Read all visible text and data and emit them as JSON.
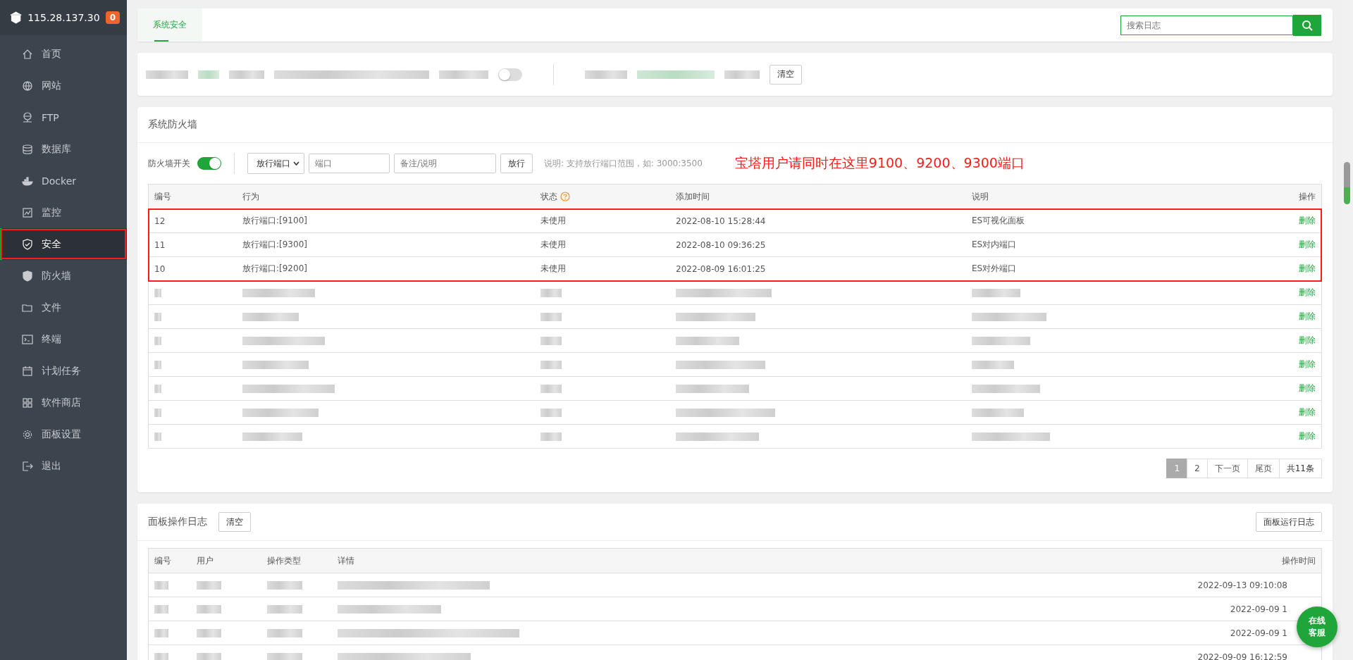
{
  "sidebar": {
    "host": "115.28.137.30",
    "badge": "0",
    "items": [
      {
        "label": "首页",
        "selected": false,
        "highlighted": false
      },
      {
        "label": "网站",
        "selected": false,
        "highlighted": false
      },
      {
        "label": "FTP",
        "selected": false,
        "highlighted": false
      },
      {
        "label": "数据库",
        "selected": false,
        "highlighted": false
      },
      {
        "label": "Docker",
        "selected": false,
        "highlighted": false
      },
      {
        "label": "监控",
        "selected": false,
        "highlighted": false
      },
      {
        "label": "安全",
        "selected": true,
        "highlighted": true
      },
      {
        "label": "防火墙",
        "selected": false,
        "highlighted": false
      },
      {
        "label": "文件",
        "selected": false,
        "highlighted": false
      },
      {
        "label": "终端",
        "selected": false,
        "highlighted": false
      },
      {
        "label": "计划任务",
        "selected": false,
        "highlighted": false
      },
      {
        "label": "软件商店",
        "selected": false,
        "highlighted": false
      },
      {
        "label": "面板设置",
        "selected": false,
        "highlighted": false
      },
      {
        "label": "退出",
        "selected": false,
        "highlighted": false
      }
    ]
  },
  "tabs": [
    {
      "label": "系统安全",
      "selected": true
    }
  ],
  "search": {
    "placeholder": "搜索日志"
  },
  "security_bar": {
    "toggle_on": false,
    "clear_button": "清空"
  },
  "firewall": {
    "title": "系统防火墙",
    "switch_label": "防火墙开关",
    "switch_on": true,
    "select_value": "放行端口",
    "port_placeholder": "端口",
    "note_placeholder": "备注/说明",
    "allow_button": "放行",
    "hint": "说明: 支持放行端口范围，如: 3000:3500",
    "annotation": "宝塔用户请同时在这里9100、9200、9300端口",
    "columns": [
      "编号",
      "行为",
      "状态",
      "添加时间",
      "说明",
      "操作"
    ],
    "rows": [
      {
        "kind": "text",
        "highlighted": true,
        "id": "12",
        "action": "放行端口:[9100]",
        "status": "未使用",
        "time": "2022-08-10 15:28:44",
        "note": "ES可视化面板",
        "op": "删除"
      },
      {
        "kind": "text",
        "highlighted": true,
        "id": "11",
        "action": "放行端口:[9300]",
        "status": "未使用",
        "time": "2022-08-10 09:36:25",
        "note": "ES对内端口",
        "op": "删除"
      },
      {
        "kind": "text",
        "highlighted": true,
        "id": "10",
        "action": "放行端口:[9200]",
        "status": "未使用",
        "time": "2022-08-09 16:01:25",
        "note": "ES对外端口",
        "op": "删除"
      },
      {
        "kind": "blurred",
        "highlighted": false,
        "op": "删除"
      },
      {
        "kind": "blurred",
        "highlighted": false,
        "op": "删除"
      },
      {
        "kind": "blurred",
        "highlighted": false,
        "op": "删除"
      },
      {
        "kind": "blurred",
        "highlighted": false,
        "op": "删除"
      },
      {
        "kind": "blurred",
        "highlighted": false,
        "op": "删除"
      },
      {
        "kind": "blurred",
        "highlighted": false,
        "op": "删除"
      },
      {
        "kind": "blurred",
        "highlighted": false,
        "op": "删除"
      }
    ],
    "pages": [
      {
        "label": "1",
        "selected": true
      },
      {
        "label": "2",
        "selected": false
      }
    ],
    "next": "下一页",
    "last": "尾页",
    "total": "共11条"
  },
  "log": {
    "title": "面板操作日志",
    "clear_button": "清空",
    "run_log_button": "面板运行日志",
    "columns": [
      "编号",
      "用户",
      "操作类型",
      "详情",
      "操作时间"
    ],
    "rows": [
      {
        "time": "2022-09-13 09:10:08"
      },
      {
        "time": "2022-09-09 1"
      },
      {
        "time": "2022-09-09 1"
      },
      {
        "time": "2022-09-09 16:12:59"
      }
    ]
  },
  "chat_button": [
    "在线",
    "客服"
  ]
}
